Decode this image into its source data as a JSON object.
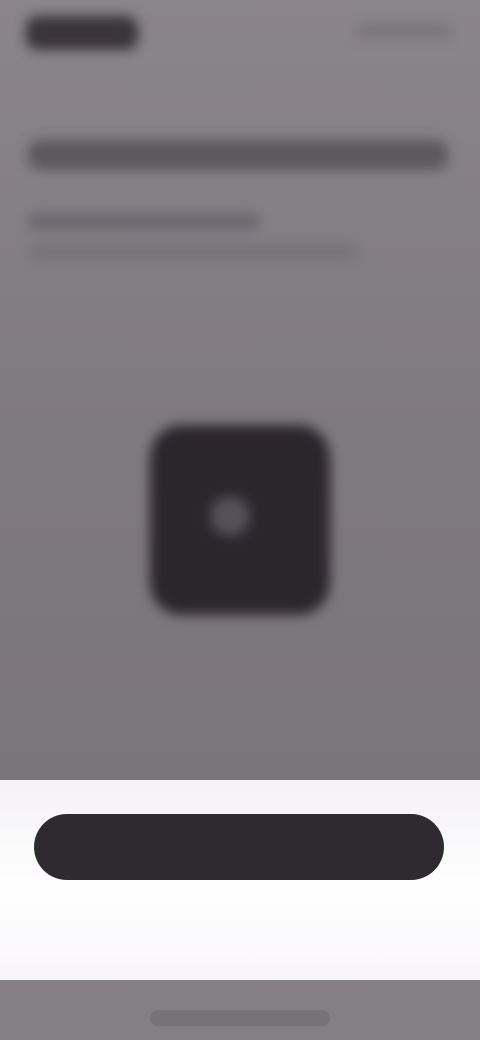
{
  "app": {
    "name": "",
    "top_right_text": ""
  },
  "content": {
    "title": "",
    "subtitle_line_1": "",
    "subtitle_line_2": "",
    "tile": {
      "icon": "image-icon"
    }
  },
  "bottom_sheet": {
    "primary_button_label": "",
    "secondary_link_label": ""
  },
  "colors": {
    "background": "#858086",
    "tile": "#2b262c",
    "primary_button": "#2f2a30",
    "sheet": "#ffffff"
  }
}
